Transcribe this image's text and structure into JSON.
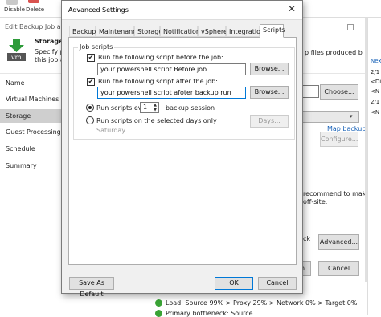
{
  "toolbar": {
    "disable_label": "Disable",
    "delete_label": "Delete"
  },
  "wizard": {
    "title": "Edit Backup Job ad-bkp",
    "step_heading": "Storage",
    "step_desc_line1": "Specify pro",
    "step_desc_line2": "this job an",
    "right_header_text": "p files produced by",
    "nav": [
      "Name",
      "Virtual Machines",
      "Storage",
      "Guest Processing",
      "Schedule",
      "Summary"
    ],
    "selected_nav": "Storage",
    "choose_label": "Choose...",
    "map_backup_label": "Map backup",
    "configure_label": "Configure...",
    "recommend_text_line1": "recommend to make",
    "recommend_text_line2": "off-site.",
    "ck_text": "ck",
    "advanced_label": "Advanced...",
    "finish_label": "n",
    "cancel_label": "Cancel",
    "status_line1": "Load: Source 99% > Proxy 29% > Network 0% > Target 0%",
    "status_line2": "Primary bottleneck: Source",
    "right_panel": {
      "header": "Nex",
      "items": [
        "2/1",
        "<Di",
        "<N",
        "2/1",
        "<N"
      ]
    }
  },
  "dialog": {
    "title": "Advanced Settings",
    "tabs": [
      "Backup",
      "Maintenance",
      "Storage",
      "Notifications",
      "vSphere",
      "Integration",
      "Scripts"
    ],
    "active_tab": "Scripts",
    "group_label": "Job scripts",
    "before_checkbox_label": "Run the following script before the job:",
    "before_checked": true,
    "before_value": "your powershell script Before job",
    "after_checkbox_label": "Run the following script after the job:",
    "after_checked": true,
    "after_value": "your powershell script afoter backup run",
    "browse_label": "Browse...",
    "run_every_label": "Run scripts every",
    "run_every_value": "1",
    "run_every_suffix": "backup session",
    "run_days_label": "Run scripts on the selected days only",
    "days_label": "Days...",
    "days_value": "Saturday",
    "save_default_label": "Save As Default",
    "ok_label": "OK",
    "cancel_label": "Cancel"
  },
  "colors": {
    "accent": "#0078d7",
    "link": "#1a63b8",
    "vm_icon_green": "#2e9b3a",
    "status_ok": "#3aa335"
  }
}
